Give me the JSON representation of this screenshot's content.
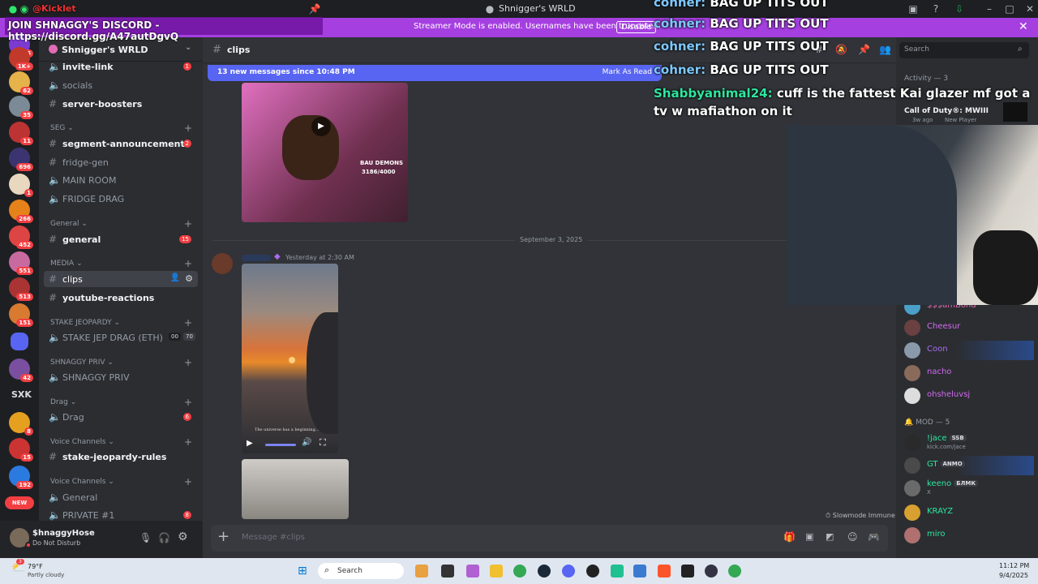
{
  "window": {
    "title": "Shnigger's WRLD"
  },
  "banner": {
    "message": "Streamer Mode is enabled. Usernames have been truncated.",
    "disable_label": "Disable"
  },
  "server_rail": {
    "badges": [
      "426",
      "1K+",
      "62",
      "35",
      "11",
      "696",
      "1",
      "266",
      "452",
      "551",
      "513",
      "151",
      "42",
      "8",
      "15",
      "192"
    ],
    "sxk_label": "SXK",
    "new_label": "NEW"
  },
  "sidebar": {
    "server_name": "Shnigger's WRLD",
    "channels": [
      {
        "label": "invite-link",
        "count": "1"
      },
      {
        "label": "socials"
      },
      {
        "label": "server-boosters"
      },
      {
        "label": "segment-announcement",
        "count": "2"
      },
      {
        "label": "fridge-gen"
      },
      {
        "label": "MAIN ROOM"
      },
      {
        "label": "FRIDGE DRAG"
      },
      {
        "label": "general",
        "count": "15"
      },
      {
        "label": "clips"
      },
      {
        "label": "youtube-reactions"
      },
      {
        "label": "STAKE JEP DRAG (ETH)",
        "extra1": "00",
        "extra2": "70"
      },
      {
        "label": "SHNAGGY PRIV"
      },
      {
        "label": "Drag",
        "count": "6"
      },
      {
        "label": "stake-jeopardy-rules"
      },
      {
        "label": "General"
      },
      {
        "label": "PRIVATE #1",
        "count": "8"
      }
    ],
    "categories": [
      "SEG",
      "General",
      "MEDIA",
      "STAKE JEOPARDY",
      "SHNAGGY PRIV",
      "Drag",
      "Voice Channels",
      "Voice Channels"
    ]
  },
  "user": {
    "name": "$hnaggyHose",
    "status": "Do Not Disturb"
  },
  "channel_header": {
    "name": "clips",
    "search_placeholder": "Search"
  },
  "new_messages": {
    "text": "13 new messages since 10:48 PM",
    "mark_read": "Mark As Read"
  },
  "chat": {
    "date_divider": "September 3, 2025",
    "timestamp": "Yesterday at 2:30 AM",
    "thumb_text1": "BAU DEMONS",
    "thumb_text2": "3186/4000",
    "video_caption": "The universe has a beginning...",
    "slowmode": "Slowmode Immune",
    "composer_placeholder": "Message #clips"
  },
  "activity": {
    "label": "Activity — 3",
    "game": "Call of Duty®: MWIII",
    "meta": "3w ago",
    "tag": "New Player"
  },
  "members_top": [
    {
      "name": "$$$amBond",
      "color": "#e06cb5"
    },
    {
      "name": "Cheesur",
      "color": "#d26cf0"
    },
    {
      "name": "Coon",
      "color": "#a86cf0"
    },
    {
      "name": "nacho",
      "color": "#d26cf0"
    },
    {
      "name": "ohsheluvsj",
      "color": "#d26cf0"
    }
  ],
  "mod_header": "MOD — 5",
  "mods": [
    {
      "name": "!jace",
      "tag": "SSB",
      "sub": "kick.com/jace"
    },
    {
      "name": "GT",
      "tag": "ANMO"
    },
    {
      "name": "keeno",
      "tag": "БЛМК",
      "sub": "X"
    },
    {
      "name": "KRAYZ"
    },
    {
      "name": "miro"
    }
  ],
  "stream_overlay": {
    "kick_user": "@Kicklet",
    "discord_promo": "JOIN SHNAGGY'S DISCORD - https://discord.gg/A47autDgvQ",
    "chat": [
      {
        "user": "cohner:",
        "text": "BAG UP TITS OUT"
      },
      {
        "user": "cohner:",
        "text": "BAG UP TITS OUT"
      },
      {
        "user": "cohner:",
        "text": "BAG UP TITS OUT"
      },
      {
        "user": "cohner:",
        "text": "BAG UP TITS OUT"
      },
      {
        "user": "Shabbyanimal24:",
        "text": "cuff is the fattest Kai glazer mf got a tv w mafiathon on it"
      }
    ]
  },
  "taskbar": {
    "weather_temp": "79°F",
    "weather_desc": "Partly cloudy",
    "search": "Search",
    "time": "11:12 PM",
    "date": "9/4/2025",
    "weather_badge": "3"
  },
  "colors": {
    "accent": "#5865f2",
    "streamer_banner": "#a53fe0",
    "mention_red": "#f23f43",
    "overlay_user": "#7ec8ff",
    "overlay_user2": "#2ee6a0"
  }
}
